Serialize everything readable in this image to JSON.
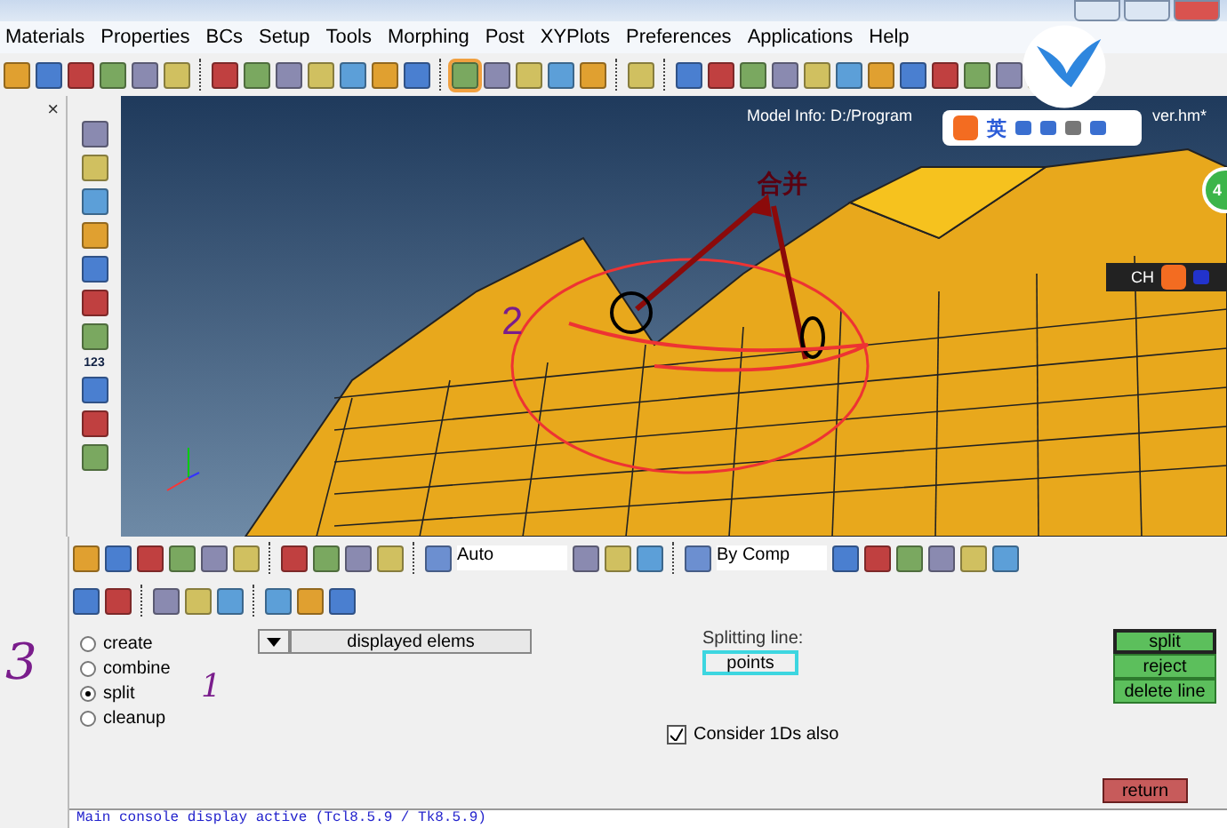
{
  "menu": [
    "Materials",
    "Properties",
    "BCs",
    "Setup",
    "Tools",
    "Morphing",
    "Post",
    "XYPlots",
    "Preferences",
    "Applications",
    "Help"
  ],
  "side_panel": {
    "close": "×",
    "icon_label": "123"
  },
  "viewport": {
    "model_info": "Model Info: D:/Program",
    "model_info_end": "ver.hm*",
    "annotation_text": "合并",
    "annotation_number": "2",
    "ime_bar": {
      "label": "英"
    },
    "lang_bar": {
      "label": "CH"
    },
    "badge": "4"
  },
  "toolbar": {
    "display_mode": "Auto",
    "color_mode": "By Comp"
  },
  "panel": {
    "options": [
      {
        "label": "create",
        "selected": false
      },
      {
        "label": "combine",
        "selected": false
      },
      {
        "label": "split",
        "selected": true
      },
      {
        "label": "cleanup",
        "selected": false
      }
    ],
    "selector": "displayed elems",
    "splitting_label": "Splitting line:",
    "points": "points",
    "consider": {
      "label": "Consider 1Ds also",
      "checked": true
    },
    "actions": [
      {
        "label": "split",
        "selected": true
      },
      {
        "label": "reject",
        "selected": false
      },
      {
        "label": "delete line",
        "selected": false
      }
    ],
    "return": "return",
    "marks": {
      "three": "3",
      "one": "1"
    }
  },
  "console": "Main console display active (Tcl8.5.9 / Tk8.5.9)"
}
